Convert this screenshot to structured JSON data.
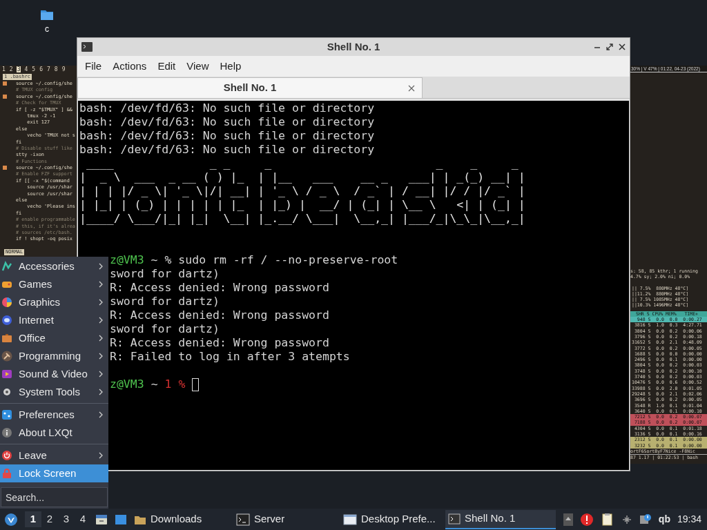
{
  "desktop_icon": {
    "label": "c"
  },
  "editor_pane": {
    "workspaces": [
      {
        "label": "1",
        "selected": false
      },
      {
        "label": "2",
        "selected": false
      },
      {
        "label": "3",
        "selected": true
      },
      {
        "label": "4",
        "selected": false
      },
      {
        "label": "5",
        "selected": false
      },
      {
        "label": "6",
        "selected": false
      },
      {
        "label": "7",
        "selected": false
      },
      {
        "label": "8",
        "selected": false
      },
      {
        "label": "9",
        "selected": false
      }
    ],
    "buffer_tab": "1 .bashrc",
    "lines": [
      {
        "text": "source ~/.config/she",
        "marked": true
      },
      {
        "text": "# TMUX config",
        "marked": false
      },
      {
        "text": "source ~/.config/she",
        "marked": true
      },
      {
        "text": "# Check for TMUX",
        "marked": false
      },
      {
        "text": "if [ -z \"$TMUX\" ] &&",
        "marked": false
      },
      {
        "text": "    tmux -2 -1",
        "marked": false
      },
      {
        "text": "    exit 127",
        "marked": false
      },
      {
        "text": "else",
        "marked": false
      },
      {
        "text": "    vecho 'TMUX not s",
        "marked": false
      },
      {
        "text": "fi",
        "marked": false
      },
      {
        "text": "# Disable stuff like",
        "marked": false
      },
      {
        "text": "stty -ixon",
        "marked": false
      },
      {
        "text": "# Functions",
        "marked": false
      },
      {
        "text": "source ~/.config/she",
        "marked": true
      },
      {
        "text": "# Enable FZF support",
        "marked": false
      },
      {
        "text": "if [[ -x \"$(command",
        "marked": false
      },
      {
        "text": "    source /usr/shar",
        "marked": false
      },
      {
        "text": "    source /usr/shar",
        "marked": false
      },
      {
        "text": "else",
        "marked": false
      },
      {
        "text": "    vecho 'Please ins",
        "marked": false
      },
      {
        "text": "fi",
        "marked": false
      },
      {
        "text": "# enable programmable",
        "marked": false
      },
      {
        "text": "# this, if it's alrea",
        "marked": false
      },
      {
        "text": "# sources /etc/bash.",
        "marked": false
      },
      {
        "text": "if ! shopt -oq posix",
        "marked": false
      }
    ],
    "mode": "NORMAL"
  },
  "monitor_pane": {
    "status": "30% | V 47% | 01:22, 04-23 (2022)",
    "summary": [
      "s: 58, 85 kthr; 1 running",
      "4.7% sy; 2.0% ni; 0.0%"
    ],
    "cpus": [
      "|| 7.5%  880MHz 48°C]",
      "||11.2%  880MHz 48°C]",
      "|| 7.5% 1085MHz 48°C]",
      "||10.3% 1496MHz 48°C]"
    ],
    "header": "SHR S CPU% MEM%   TIME+",
    "rows": [
      {
        "text": "  948 S  0.0  0.0  0:00.27",
        "color": "#4fb8b0"
      },
      {
        "text": " 3816 S  1.0  0.3  4:27.71"
      },
      {
        "text": " 3804 S  0.0  0.2  0:00.06"
      },
      {
        "text": " 3796 S  0.0  0.2  0:00.18"
      },
      {
        "text": "31652 S  0.0  2.1  0:48.09"
      },
      {
        "text": " 3772 S  0.0  0.2  0:00.05"
      },
      {
        "text": " 1688 S  0.0  0.0  0:00.00"
      },
      {
        "text": " 2496 S  0.0  0.1  0:00.00"
      },
      {
        "text": " 3804 S  0.0  0.2  0:00.03"
      },
      {
        "text": " 3748 S  0.0  0.2  0:00.10"
      },
      {
        "text": " 3740 S  0.0  0.2  0:00.03"
      },
      {
        "text": "10476 S  0.0  0.6  0:00.52"
      },
      {
        "text": "33988 S  0.0  2.0  0:01.05"
      },
      {
        "text": "29248 S  0.0  2.1  0:02.06"
      },
      {
        "text": " 3696 S  0.0  0.2  0:00.05"
      },
      {
        "text": " 3548 R  1.0  0.1  0:01.04"
      },
      {
        "text": " 3640 S  0.0  0.1  0:00.10"
      },
      {
        "text": " 7212 S  0.0  0.2  0:00.07",
        "color": "#c0505a"
      },
      {
        "text": " 7188 S  0.0  0.2  0:00.07",
        "color": "#c0505a"
      },
      {
        "text": " 4304 S  0.0  0.1  0:01.18"
      },
      {
        "text": " 3136 S  0.0  0.1  0:00.16"
      },
      {
        "text": " 2312 S  0.0  0.1  0:00.00",
        "color": "#b8b070"
      },
      {
        "text": " 3232 S  0.0  0.1  0:00.00",
        "color": "#b8b070"
      }
    ],
    "keys": "ortF6SortByF7Nice -F8Nic",
    "footer": "87 1.17 | 01:22:53 | bash"
  },
  "window": {
    "title": "Shell No. 1",
    "menu": [
      "File",
      "Actions",
      "Edit",
      "View",
      "Help"
    ],
    "tabs": [
      {
        "label": "Shell No. 1",
        "selected": true
      }
    ],
    "terminal": {
      "errors": [
        "bash: /dev/fd/63: No such file or directory",
        "bash: /dev/fd/63: No such file or directory",
        "bash: /dev/fd/63: No such file or directory",
        "bash: /dev/fd/63: No such file or directory"
      ],
      "banner": [
        " ____              _ _     _                        _    _     _",
        "|  _ \\  ___  _ __ ( ) |_  | |__   ___    __ _   ___| | _(_) __| |",
        "| | | |/ _ \\| '_ \\|/| __| | '_ \\ / _ \\  / _` | / __| |/ / |/ _` |",
        "| |_| | (_) | | | | | |_  | |_) |  __/ | (_| | \\__ \\   <| | (_| |",
        "|____/ \\___/|_| |_|  \\__| |_.__/ \\___|  \\__,_| |___/_|\\_\\_|\\__,_|"
      ],
      "session": [
        {
          "kind": "command",
          "user": "z@VM3",
          "text": "~ % sudo rm -rf / --no-preserve-root"
        },
        {
          "kind": "output",
          "text": "sword for dartz)"
        },
        {
          "kind": "output",
          "text": "R: Access denied: Wrong password"
        },
        {
          "kind": "output",
          "text": "sword for dartz)"
        },
        {
          "kind": "output",
          "text": "R: Access denied: Wrong password"
        },
        {
          "kind": "output",
          "text": "sword for dartz)"
        },
        {
          "kind": "output",
          "text": "R: Access denied: Wrong password"
        },
        {
          "kind": "output",
          "text": "R: Failed to log in after 3 atempts"
        }
      ],
      "prompt": {
        "user": "z@VM3",
        "path": "~",
        "status": "1 %"
      }
    }
  },
  "app_menu": {
    "groups": [
      [
        {
          "label": "Accessories",
          "kind": "submenu",
          "selected": false
        },
        {
          "label": "Games",
          "kind": "submenu",
          "selected": false
        },
        {
          "label": "Graphics",
          "kind": "submenu",
          "selected": false
        },
        {
          "label": "Internet",
          "kind": "submenu",
          "selected": false
        },
        {
          "label": "Office",
          "kind": "submenu",
          "selected": false
        },
        {
          "label": "Programming",
          "kind": "submenu",
          "selected": false
        },
        {
          "label": "Sound & Video",
          "kind": "submenu",
          "selected": false
        },
        {
          "label": "System Tools",
          "kind": "submenu",
          "selected": false
        }
      ],
      [
        {
          "label": "Preferences",
          "kind": "submenu",
          "selected": false
        },
        {
          "label": "About LXQt",
          "kind": "action",
          "selected": false
        }
      ],
      [
        {
          "label": "Leave",
          "kind": "submenu",
          "selected": false
        },
        {
          "label": "Lock Screen",
          "kind": "action",
          "selected": true
        }
      ]
    ],
    "search": {
      "placeholder": "Search..."
    }
  },
  "taskbar": {
    "desktops": [
      {
        "label": "1",
        "selected": true
      },
      {
        "label": "2",
        "selected": false
      },
      {
        "label": "3",
        "selected": false
      },
      {
        "label": "4",
        "selected": false
      }
    ],
    "tasks": [
      {
        "label": "Downloads",
        "selected": false
      },
      {
        "label": "Server",
        "selected": false
      },
      {
        "label": "Desktop Prefe...",
        "selected": false
      },
      {
        "label": "Shell No. 1",
        "selected": true
      }
    ],
    "tray_text": "qb",
    "clock": "19:34"
  }
}
